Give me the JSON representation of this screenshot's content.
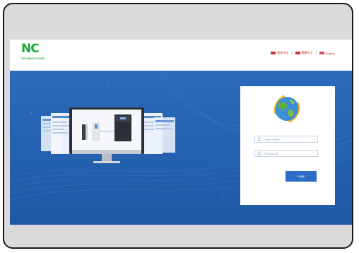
{
  "header": {
    "logo": {
      "mark": "NC",
      "subtitle": "TECHNOLOGIES"
    },
    "languages": [
      {
        "label": "简体中文"
      },
      {
        "label": "繁體中文"
      },
      {
        "label": "English"
      }
    ]
  },
  "login": {
    "username_placeholder": "User Name",
    "password_placeholder": "Password",
    "login_label": "Login"
  },
  "colors": {
    "brand_green": "#1aa83a",
    "hero_blue": "#2464b4",
    "button_blue": "#2a6cc6",
    "frame_gray": "#dadada"
  },
  "icons": {
    "user": "user-icon",
    "lock": "lock-icon",
    "globe": "globe-icon",
    "flag": "flag-icon"
  }
}
